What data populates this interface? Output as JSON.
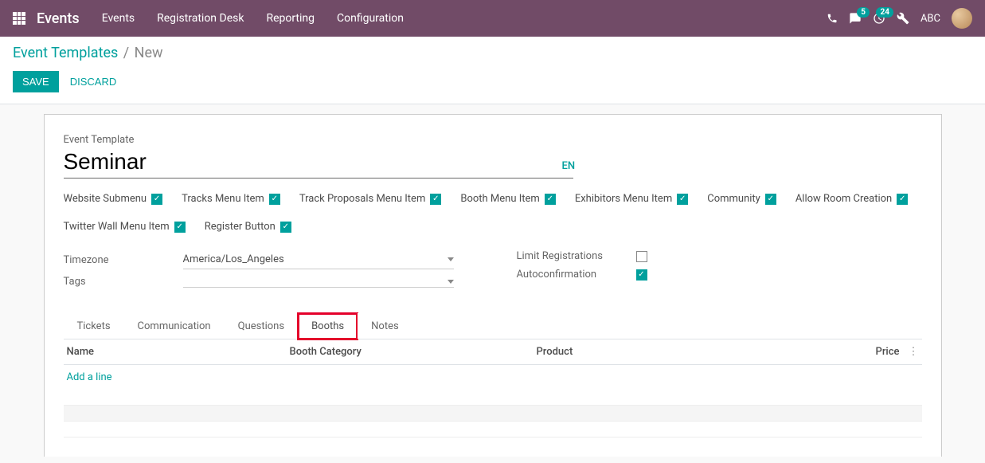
{
  "navbar": {
    "brand": "Events",
    "menu": [
      "Events",
      "Registration Desk",
      "Reporting",
      "Configuration"
    ],
    "msg_badge": "5",
    "activity_badge": "24",
    "user": "ABC"
  },
  "breadcrumb": {
    "parent": "Event Templates",
    "current": "New"
  },
  "buttons": {
    "save": "Save",
    "discard": "Discard"
  },
  "form": {
    "label_event_template": "Event Template",
    "name": "Seminar",
    "lang": "EN",
    "checks": [
      {
        "label": "Website Submenu",
        "checked": true
      },
      {
        "label": "Tracks Menu Item",
        "checked": true
      },
      {
        "label": "Track Proposals Menu Item",
        "checked": true
      },
      {
        "label": "Booth Menu Item",
        "checked": true
      },
      {
        "label": "Exhibitors Menu Item",
        "checked": true
      },
      {
        "label": "Community",
        "checked": true
      },
      {
        "label": "Allow Room Creation",
        "checked": true
      },
      {
        "label": "Twitter Wall Menu Item",
        "checked": true
      },
      {
        "label": "Register Button",
        "checked": true
      }
    ],
    "timezone_label": "Timezone",
    "timezone_value": "America/Los_Angeles",
    "tags_label": "Tags",
    "tags_value": "",
    "limit_label": "Limit Registrations",
    "limit_checked": false,
    "autoconf_label": "Autoconfirmation",
    "autoconf_checked": true
  },
  "tabs": [
    "Tickets",
    "Communication",
    "Questions",
    "Booths",
    "Notes"
  ],
  "active_tab": 3,
  "highlight_tab": 3,
  "table": {
    "headers": [
      "Name",
      "Booth Category",
      "Product",
      "Price"
    ],
    "add_line": "Add a line"
  }
}
